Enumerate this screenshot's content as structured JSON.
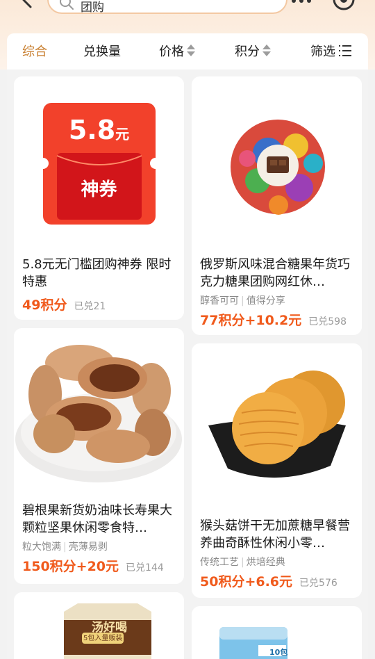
{
  "search": {
    "query": "团购"
  },
  "tabs": [
    {
      "label": "综合"
    },
    {
      "label": "兑换量"
    },
    {
      "label": "价格"
    },
    {
      "label": "积分"
    },
    {
      "label": "筛选"
    }
  ],
  "products": [
    {
      "coupon_value": "5.8",
      "coupon_unit": "元",
      "coupon_label": "神券",
      "title": "5.8元无门槛团购神券 限时特惠",
      "tags": [],
      "price": "49积分",
      "sold": "已兑21"
    },
    {
      "title": "俄罗斯风味混合糖果年货巧克力糖果团购网红休…",
      "tags": [
        "醇香可可",
        "值得分享"
      ],
      "price": "77积分+10.2元",
      "sold": "已兑598"
    },
    {
      "title": "碧根果新货奶油味长寿果大颗粒坚果休闲零食特…",
      "tags": [
        "粒大饱满",
        "壳薄易剥"
      ],
      "price": "150积分+20元",
      "sold": "已兑144"
    },
    {
      "title": "猴头菇饼干无加蔗糖早餐营养曲奇酥性休闲小零…",
      "tags": [
        "传统工艺",
        "烘培经典"
      ],
      "price": "50积分+6.6元",
      "sold": "已兑576"
    },
    {
      "package_brand": "汤好喝",
      "package_sub": "5包入量贩装",
      "title": "",
      "tags": [],
      "price": "",
      "sold": ""
    },
    {
      "package_count": "10包",
      "title": "",
      "tags": [],
      "price": "",
      "sold": ""
    }
  ],
  "colors": {
    "accent": "#c87e2e",
    "price": "#f05a1c",
    "coupon_red": "#f2412b"
  }
}
